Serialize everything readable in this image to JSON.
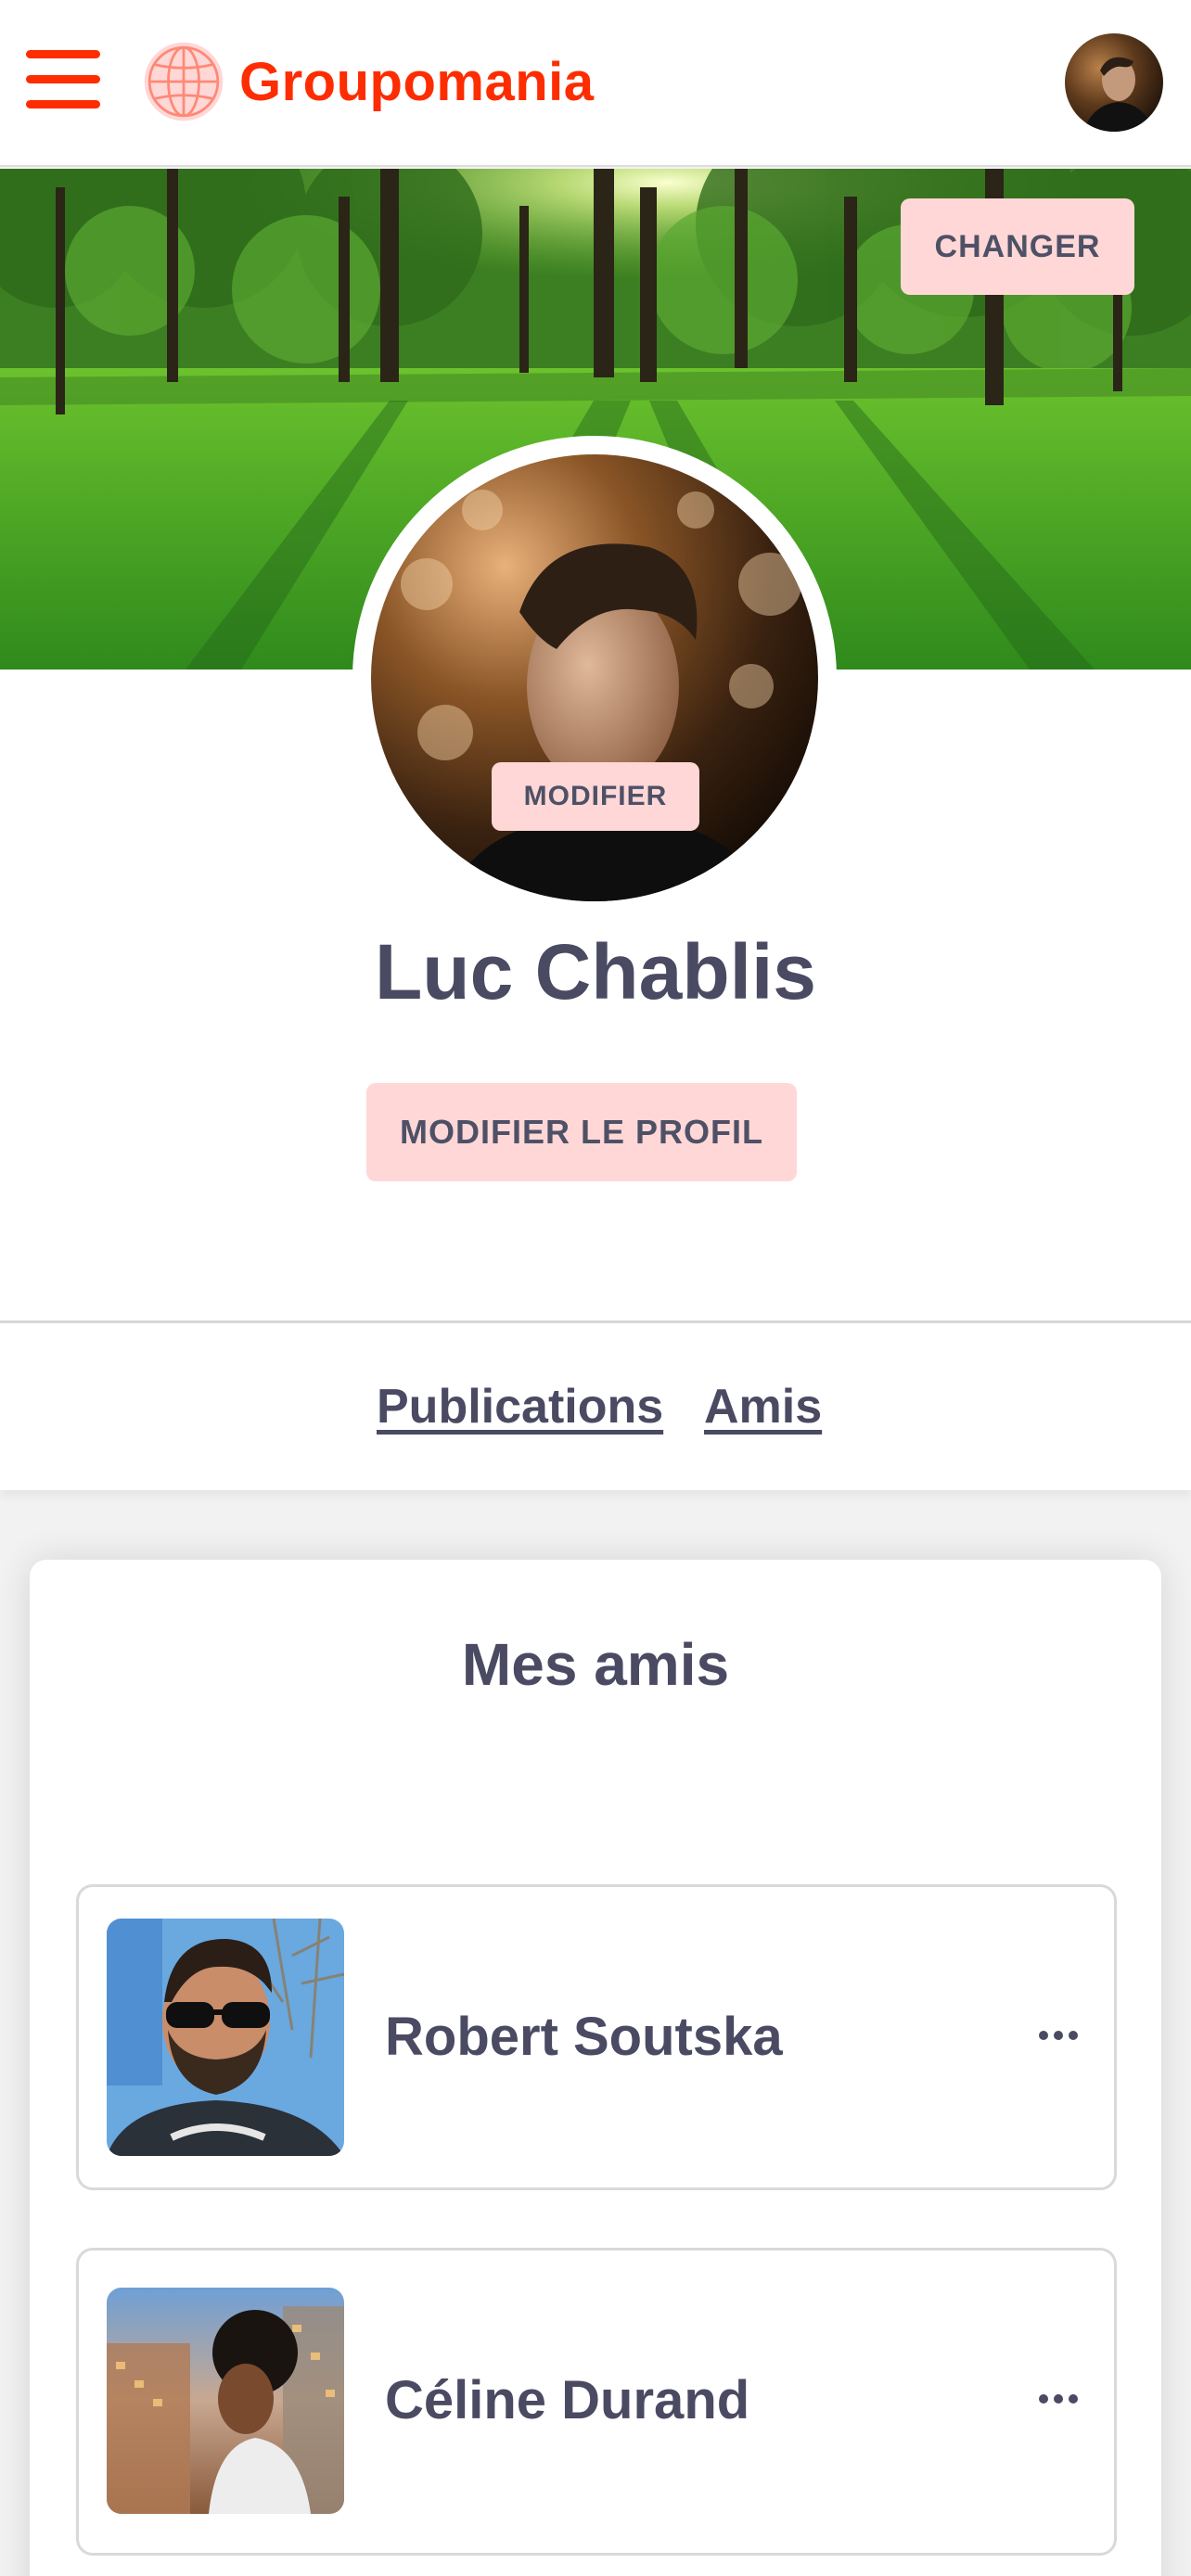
{
  "app": {
    "name": "Groupomania",
    "brand_color": "#fd2d01"
  },
  "header": {
    "menu_icon": "hamburger-menu-icon",
    "logo_icon": "globe-icon",
    "avatar": "user-avatar"
  },
  "cover": {
    "change_label": "CHANGER"
  },
  "profile": {
    "avatar_edit_label": "MODIFIER",
    "name": "Luc Chablis",
    "edit_profile_label": "MODIFIER LE PROFIL"
  },
  "tabs": [
    {
      "label": "Publications"
    },
    {
      "label": "Amis"
    }
  ],
  "friends": {
    "title": "Mes amis",
    "items": [
      {
        "name": "Robert Soutska",
        "menu_icon": "more-dots-icon"
      },
      {
        "name": "Céline Durand",
        "menu_icon": "more-dots-icon"
      }
    ]
  },
  "colors": {
    "button_bg": "#ffd7d7",
    "text": "#4a4a63",
    "accent": "#fd2d01"
  }
}
